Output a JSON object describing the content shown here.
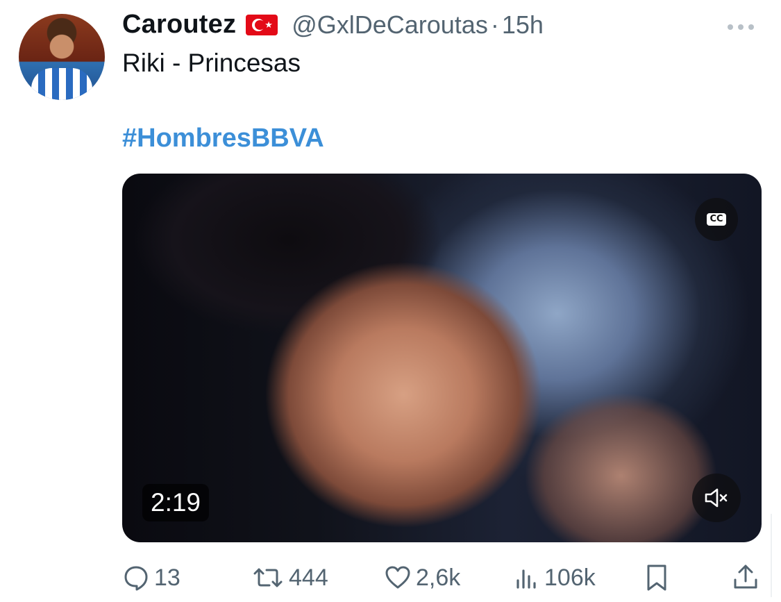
{
  "tweet": {
    "author_name": "Caroutez",
    "author_flag": "turkey-flag-icon",
    "handle": "@GxlDeCaroutas",
    "separator": "·",
    "time": "15h",
    "text": "Riki - Princesas",
    "hashtag": "#HombresBBVA"
  },
  "video": {
    "duration": "2:19",
    "cc_label": "CC",
    "cc_icon": "closed-captions-icon",
    "mute_icon": "speaker-muted-icon"
  },
  "actions": {
    "reply": {
      "icon": "reply-icon",
      "count": "13"
    },
    "retweet": {
      "icon": "retweet-icon",
      "count": "444"
    },
    "like": {
      "icon": "heart-icon",
      "count": "2,6k"
    },
    "views": {
      "icon": "views-chart-icon",
      "count": "106k"
    },
    "bookmark": {
      "icon": "bookmark-icon"
    },
    "share": {
      "icon": "share-icon"
    }
  },
  "colors": {
    "hashtag": "#3c8fd8",
    "secondary_text": "#536471",
    "flag_red": "#e30a17"
  }
}
